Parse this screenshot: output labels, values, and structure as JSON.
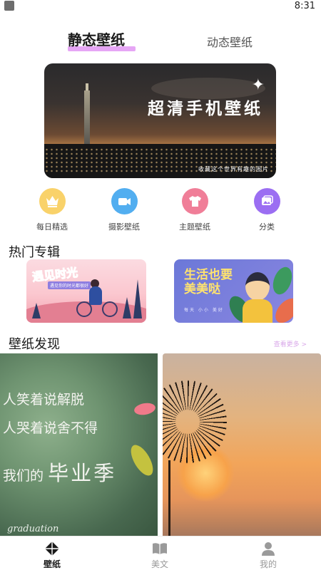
{
  "status_bar": {
    "time": "8:31"
  },
  "top_tabs": [
    {
      "label": "静态壁纸",
      "active": true
    },
    {
      "label": "动态壁纸",
      "active": false
    }
  ],
  "banner": {
    "title": "超清手机壁纸",
    "caption": "收藏这个世界有趣的图片"
  },
  "categories": [
    {
      "label": "每日精选",
      "icon": "crown-icon",
      "color": "#f9d26a"
    },
    {
      "label": "摄影壁纸",
      "icon": "video-camera-icon",
      "color": "#52aef0"
    },
    {
      "label": "主题壁纸",
      "icon": "shirt-icon",
      "color": "#f07e98"
    },
    {
      "label": "分类",
      "icon": "gallery-icon",
      "color": "#9b6ef2"
    }
  ],
  "hot_albums": {
    "title": "热门专辑",
    "items": [
      {
        "title": "遇见时光",
        "subtitle": "遇见你的时光都很好"
      },
      {
        "title": "生活也要美美哒",
        "subtitle": "每天 小小 美好"
      }
    ]
  },
  "discover": {
    "title": "壁纸发现",
    "more_label": "查看更多 >",
    "cards": [
      {
        "lines": [
          "人笑着说解脱",
          "人哭着说舍不得",
          "我们的"
        ],
        "highlight": "毕业季",
        "caption": "graduation"
      },
      {
        "subject": "dandelion-sunset"
      }
    ]
  },
  "bottom_nav": [
    {
      "label": "壁纸",
      "icon": "diamond-icon",
      "active": true
    },
    {
      "label": "美文",
      "icon": "book-icon",
      "active": false
    },
    {
      "label": "我的",
      "icon": "user-icon",
      "active": false
    }
  ],
  "colors": {
    "accent": "#e6a6f5",
    "more_link": "#d9a8e9"
  }
}
